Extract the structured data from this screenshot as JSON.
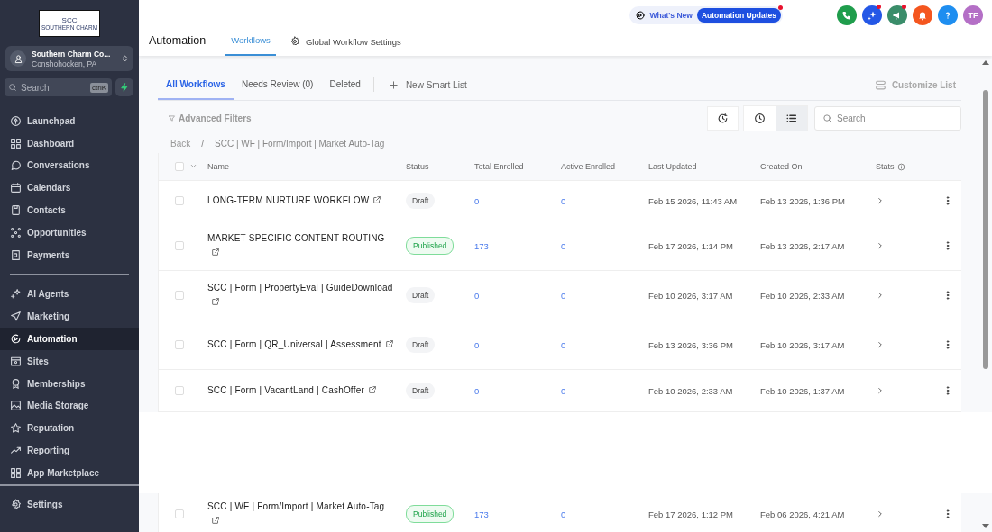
{
  "sidebar": {
    "logo": {
      "initials": "SCC",
      "name": "SOUTHERN CHARM"
    },
    "account": {
      "name": "Southern Charm Co...",
      "location": "Conshohocken, PA"
    },
    "search": {
      "placeholder": "Search",
      "shortcut": "ctrlK"
    },
    "nav_groups": [
      {
        "items": [
          {
            "label": "Launchpad",
            "selected": false
          },
          {
            "label": "Dashboard",
            "selected": false
          },
          {
            "label": "Conversations",
            "selected": false
          },
          {
            "label": "Calendars",
            "selected": false
          },
          {
            "label": "Contacts",
            "selected": false
          },
          {
            "label": "Opportunities",
            "selected": false
          },
          {
            "label": "Payments",
            "selected": false
          }
        ]
      },
      {
        "items": [
          {
            "label": "AI Agents",
            "selected": false
          },
          {
            "label": "Marketing",
            "selected": false
          },
          {
            "label": "Automation",
            "selected": true
          },
          {
            "label": "Sites",
            "selected": false
          },
          {
            "label": "Memberships",
            "selected": false
          },
          {
            "label": "Media Storage",
            "selected": false
          },
          {
            "label": "Reputation",
            "selected": false
          },
          {
            "label": "Reporting",
            "selected": false
          },
          {
            "label": "App Marketplace",
            "selected": false
          }
        ]
      },
      {
        "items": [
          {
            "label": "Settings",
            "selected": false
          }
        ]
      }
    ]
  },
  "header": {
    "title": "Automation",
    "tabs": [
      {
        "label": "Workflows",
        "selected": true
      }
    ],
    "settings_link": "Global Workflow Settings",
    "whats_new": {
      "label": "What's New",
      "badge": "Automation Updates",
      "unread": true
    },
    "actions": [
      {
        "kind": "phone",
        "color": "#1f9d4c",
        "unread": false
      },
      {
        "kind": "sparkle",
        "color": "#2457e6",
        "unread": true
      },
      {
        "kind": "megaphone",
        "color": "#3a8d6a",
        "unread": true
      },
      {
        "kind": "bell",
        "color": "#f4561f",
        "unread": false
      },
      {
        "kind": "help",
        "color": "#1e8ef0",
        "unread": false
      }
    ],
    "avatar": {
      "initials": "TF",
      "color": "#b46fc6"
    }
  },
  "list_tabs": [
    {
      "label": "All Workflows",
      "selected": true
    },
    {
      "label": "Needs Review (0)",
      "selected": false
    },
    {
      "label": "Deleted",
      "selected": false
    }
  ],
  "new_smart_list": "New Smart List",
  "customize": "Customize List",
  "filters": "Advanced Filters",
  "view_modes": [
    {
      "kind": "clock",
      "selected": false
    },
    {
      "kind": "list",
      "selected": true
    }
  ],
  "search": {
    "placeholder": "Search"
  },
  "breadcrumb": {
    "back": "Back",
    "separator": "/",
    "path": "SCC | WF | Form/Import | Market Auto-Tag"
  },
  "table": {
    "select_all_checked": false,
    "columns": [
      "Name",
      "Status",
      "Total Enrolled",
      "Active Enrolled",
      "Last Updated",
      "Created On",
      "Stats"
    ],
    "rows": [
      {
        "name": "LONG-TERM NURTURE WORKFLOW",
        "status": {
          "label": "Draft",
          "kind": "draft"
        },
        "total": "0",
        "active": "0",
        "updated": "Feb 15 2026, 11:43 AM",
        "created": "Feb 13 2026, 1:36 PM",
        "checked": false
      },
      {
        "name": "MARKET-SPECIFIC CONTENT ROUTING",
        "status": {
          "label": "Published",
          "kind": "published"
        },
        "total": "173",
        "active": "0",
        "updated": "Feb 17 2026, 1:14 PM",
        "created": "Feb 13 2026, 2:17 AM",
        "checked": false
      },
      {
        "name": "SCC | Form | PropertyEval | GuideDownload",
        "status": {
          "label": "Draft",
          "kind": "draft"
        },
        "total": "0",
        "active": "0",
        "updated": "Feb 10 2026, 3:17 AM",
        "created": "Feb 10 2026, 2:33 AM",
        "checked": false
      },
      {
        "name": "SCC | Form | QR_Universal | Assessment",
        "status": {
          "label": "Draft",
          "kind": "draft"
        },
        "total": "0",
        "active": "0",
        "updated": "Feb 13 2026, 3:36 PM",
        "created": "Feb 10 2026, 3:17 AM",
        "checked": false
      },
      {
        "name": "SCC | Form | VacantLand | CashOffer",
        "status": {
          "label": "Draft",
          "kind": "draft"
        },
        "total": "0",
        "active": "0",
        "updated": "Feb 10 2026, 2:33 AM",
        "created": "Feb 10 2026, 1:37 AM",
        "checked": false
      }
    ],
    "rows_after_gap": [
      {
        "name": "SCC | WF | Form/Import | Market Auto-Tag",
        "status": {
          "label": "Published",
          "kind": "published"
        },
        "total": "173",
        "active": "0",
        "updated": "Feb 17 2026, 1:12 PM",
        "created": "Feb 06 2026, 4:21 AM",
        "checked": false
      }
    ]
  }
}
